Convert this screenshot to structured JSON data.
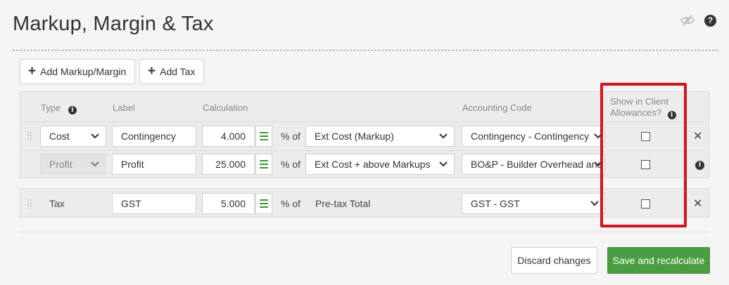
{
  "page": {
    "title": "Markup, Margin & Tax"
  },
  "toolbar": {
    "add_markup_label": "Add Markup/Margin",
    "add_tax_label": "Add Tax"
  },
  "headers": {
    "type": "Type",
    "label": "Label",
    "calculation": "Calculation",
    "accounting_code": "Accounting Code",
    "show_in_client_line1": "Show in Client",
    "show_in_client_line2": "Allowances?"
  },
  "rows": [
    {
      "type": "Cost",
      "label": "Contingency",
      "value": "4.000",
      "pct_of": "% of",
      "basis": "Ext Cost (Markup)",
      "accounting_code": "Contingency - Contingency",
      "show_in_client": false
    },
    {
      "type": "Profit",
      "label": "Profit",
      "value": "25.000",
      "pct_of": "% of",
      "basis": "Ext Cost + above Markups",
      "accounting_code": "BO&P - Builder Overhead and Profit",
      "show_in_client": false
    }
  ],
  "tax_row": {
    "type": "Tax",
    "label": "GST",
    "value": "5.000",
    "pct_of": "% of",
    "basis": "Pre-tax Total",
    "accounting_code": "GST - GST",
    "show_in_client": false
  },
  "actions": {
    "discard_label": "Discard changes",
    "save_label": "Save and recalculate"
  },
  "colors": {
    "accent_green": "#4a9e3f",
    "highlight_red": "#d9121b"
  }
}
